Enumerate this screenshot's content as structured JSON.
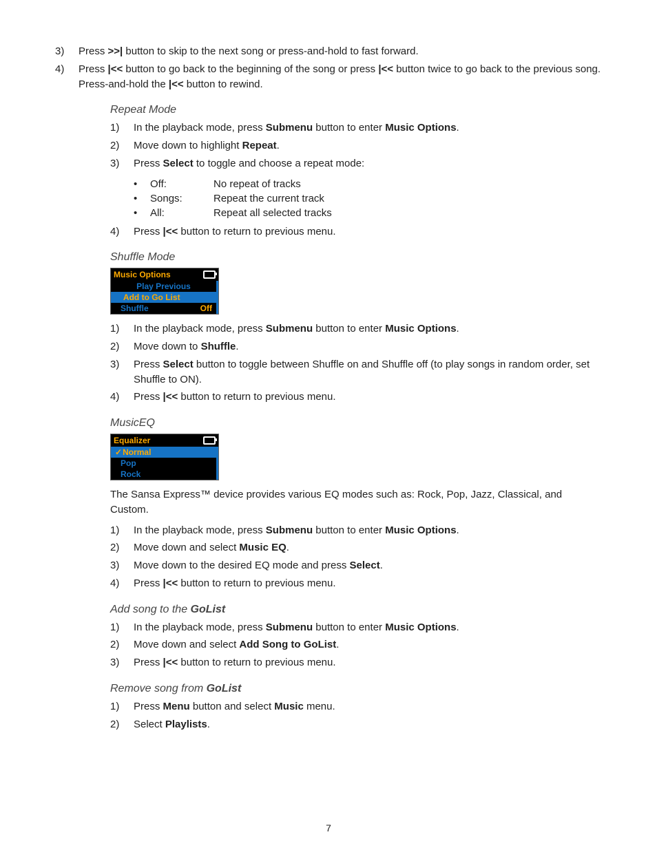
{
  "outer_list": {
    "item3": {
      "num": "3)",
      "pre": "Press ",
      "btn": ">>|",
      "post": " button to skip to the next song or press-and-hold to fast forward."
    },
    "item4": {
      "num": "4)",
      "pre": "Press ",
      "btn1": "|<<",
      "mid1": " button to go back to the beginning of the song or press ",
      "btn2": "|<<",
      "mid2": " button twice to go back to the previous song.  Press-and-hold the ",
      "btn3": "|<<",
      "post": " button to rewind."
    }
  },
  "repeat": {
    "heading": "Repeat Mode",
    "items": [
      {
        "num": "1)",
        "pre": "In the playback mode, press ",
        "b1": "Submenu",
        "mid": " button to enter ",
        "b2": "Music Options",
        "post": "."
      },
      {
        "num": "2)",
        "pre": "Move down to highlight ",
        "b1": "Repeat",
        "post": "."
      },
      {
        "num": "3)",
        "pre": "Press ",
        "b1": "Select",
        "post": " to toggle and choose a repeat mode:"
      }
    ],
    "bullets": [
      {
        "label": "Off:",
        "value": "No repeat of tracks"
      },
      {
        "label": "Songs:",
        "value": "Repeat the current track"
      },
      {
        "label": "All:",
        "value": "Repeat all selected tracks"
      }
    ],
    "item4": {
      "num": "4)",
      "pre": "Press ",
      "b1": "|<<",
      "post": " button to return to previous menu."
    }
  },
  "shuffle": {
    "heading": "Shuffle Mode",
    "screen": {
      "title": "Music Options",
      "rows": [
        {
          "label": "Play Previous",
          "sel": false,
          "arrows": ""
        },
        {
          "label": "Add to Go List",
          "sel": true,
          "arrows": "lr"
        },
        {
          "label": "Shuffle",
          "sel": false,
          "off": "Off"
        }
      ]
    },
    "items": [
      {
        "num": "1)",
        "pre": "In the playback mode, press ",
        "b1": "Submenu",
        "mid": " button to enter ",
        "b2": "Music Options",
        "post": "."
      },
      {
        "num": "2)",
        "pre": "Move down to ",
        "b1": "Shuffle",
        "post": "."
      },
      {
        "num": "3)",
        "pre": "Press ",
        "b1": "Select",
        "post": " button to toggle between Shuffle on and Shuffle off (to play songs in random order, set Shuffle to ON)."
      },
      {
        "num": "4)",
        "pre": "Press ",
        "b1": "|<<",
        "post": " button to return to previous menu."
      }
    ]
  },
  "musiceq": {
    "heading": "MusicEQ",
    "screen": {
      "title": "Equalizer",
      "rows": [
        {
          "label": "Normal",
          "sel": true,
          "check": true
        },
        {
          "label": "Pop",
          "sel": false
        },
        {
          "label": "Rock",
          "sel": false
        }
      ]
    },
    "intro": "The Sansa Express™ device provides various EQ modes such as:  Rock, Pop, Jazz, Classical, and Custom.",
    "items": [
      {
        "num": "1)",
        "pre": "In the playback mode, press ",
        "b1": "Submenu",
        "mid": " button to enter ",
        "b2": "Music Options",
        "post": "."
      },
      {
        "num": "2)",
        "pre": "Move down and select ",
        "b1": "Music EQ",
        "post": "."
      },
      {
        "num": "3)",
        "pre": "Move down to the desired EQ mode and press ",
        "b1": "Select",
        "post": "."
      },
      {
        "num": "4)",
        "pre": "Press ",
        "b1": "|<<",
        "post": " button to return to previous menu."
      }
    ]
  },
  "addsong": {
    "heading_pre": "Add song to the ",
    "heading_b": "GoList",
    "items": [
      {
        "num": "1)",
        "pre": "In the playback mode, press ",
        "b1": "Submenu",
        "mid": " button to enter ",
        "b2": "Music Options",
        "post": "."
      },
      {
        "num": "2)",
        "pre": "Move down and select ",
        "b1": "Add Song to GoList",
        "post": "."
      },
      {
        "num": "3)",
        "pre": "Press ",
        "b1": "|<<",
        "post": " button to return to previous menu."
      }
    ]
  },
  "removesong": {
    "heading_pre": "Remove song from ",
    "heading_b": "GoList",
    "items": [
      {
        "num": "1)",
        "pre": "Press ",
        "b1": "Menu",
        "mid": " button and select ",
        "b2": "Music",
        "post": " menu."
      },
      {
        "num": "2)",
        "pre": "Select ",
        "b1": "Playlists",
        "post": "."
      }
    ]
  },
  "page_number": "7"
}
